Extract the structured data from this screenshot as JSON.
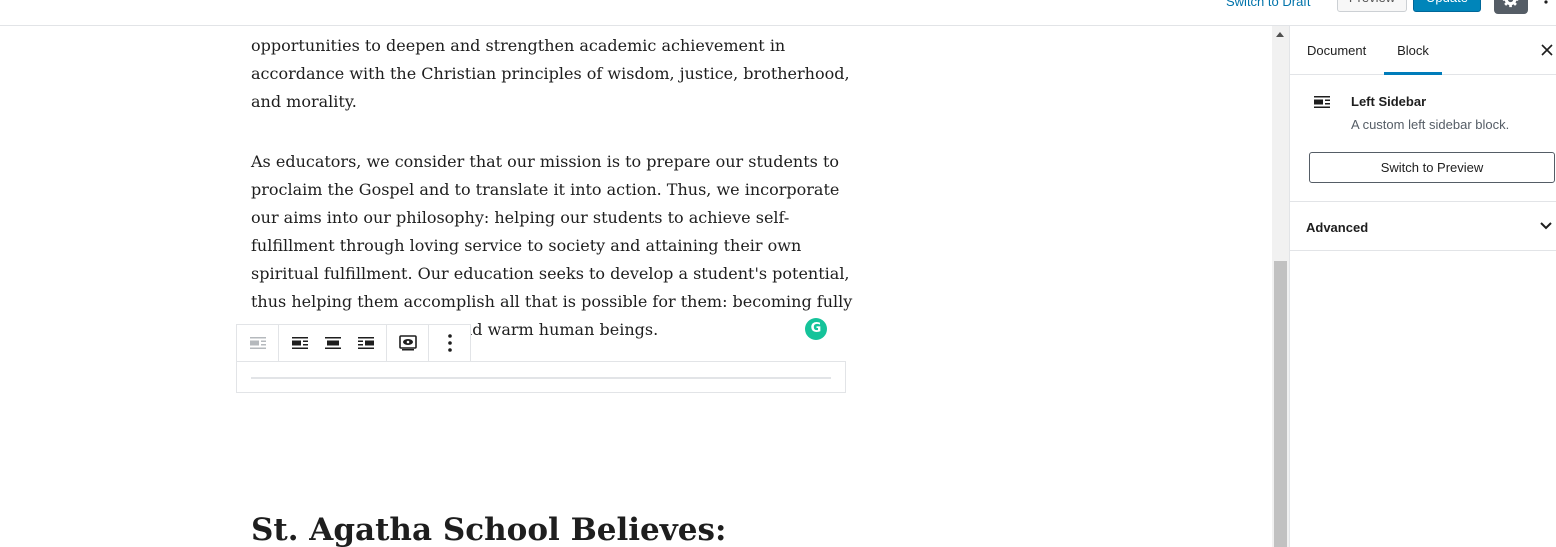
{
  "header": {
    "switch_to_draft": "Switch to Draft",
    "preview": "Preview",
    "update": "Update",
    "settings_icon": "gear-icon",
    "more_icon": "more-vertical-icon"
  },
  "content": {
    "para1_lines": [
      "opportunities to deepen and strengthen academic achievement in",
      "accordance with the Christian principles of wisdom, justice, brotherhood,",
      "and morality."
    ],
    "para2_lines": [
      "As educators, we consider that our mission is to prepare our students to",
      "proclaim the Gospel and to translate it into action.  Thus, we incorporate",
      "our aims into our philosophy: helping our students to achieve self-",
      "fulfillment through loving service to society and attaining their own",
      "spiritual fulfillment.  Our education seeks to develop a student's potential,",
      "thus helping them accomplish all that is possible for them: becoming fully",
      "nd warm human beings."
    ],
    "heading": "St. Agatha School Believes:"
  },
  "toolbar": {
    "buttons": [
      "left-sidebar-block-icon",
      "align-left-icon",
      "align-center-icon",
      "align-right-icon",
      "preview-eye-icon",
      "more-options-icon"
    ]
  },
  "grammarly": {
    "letter": "G",
    "color": "#15c39a"
  },
  "sidebar": {
    "tabs": {
      "document": "Document",
      "block": "Block"
    },
    "block_name": "Left Sidebar",
    "block_description": "A custom left sidebar block.",
    "switch_button": "Switch to Preview",
    "advanced_label": "Advanced"
  },
  "colors": {
    "accent": "#007cba",
    "primary_button": "#0085ba",
    "link": "#0073aa"
  }
}
